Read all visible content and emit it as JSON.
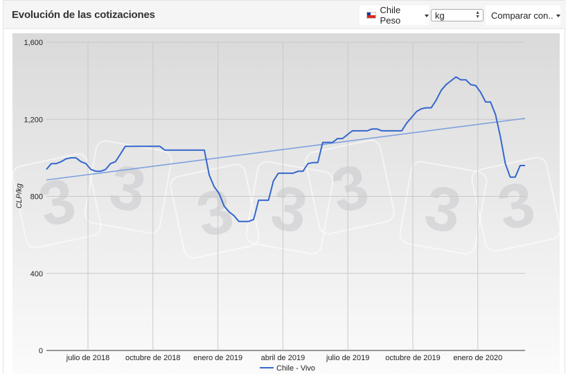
{
  "header": {
    "title": "Evolución de las cotizaciones",
    "currency_label": "Chile Peso",
    "unit_value": "kg",
    "compare_label": "Comparar con.."
  },
  "colors": {
    "series": "#3366cc",
    "trend": "#7fa0dd",
    "flag": [
      "#0039a6",
      "#ffffff",
      "#d52b1e"
    ]
  },
  "chart_data": {
    "type": "line",
    "ylabel": "CLP/kg",
    "ylim": [
      0,
      1600
    ],
    "yticks": [
      "0",
      "400",
      "800",
      "1,200",
      "1,600"
    ],
    "xtick_labels": [
      "julio de 2018",
      "octubre de 2018",
      "enero de 2019",
      "abril de 2019",
      "julio de 2019",
      "octubre de 2019",
      "enero de 2020"
    ],
    "grid": true,
    "legend_position": "bottom",
    "watermark": "3",
    "series": [
      {
        "name": "Chile - Vivo",
        "values": [
          940,
          970,
          970,
          980,
          995,
          1000,
          1000,
          980,
          970,
          940,
          930,
          930,
          940,
          970,
          980,
          1020,
          1060,
          1060,
          1060,
          1060,
          1060,
          1060,
          1060,
          1060,
          1040,
          1040,
          1040,
          1040,
          1040,
          1040,
          1040,
          1040,
          1040,
          910,
          850,
          815,
          750,
          720,
          700,
          670,
          670,
          670,
          680,
          780,
          780,
          780,
          880,
          920,
          920,
          920,
          920,
          930,
          930,
          970,
          975,
          975,
          1080,
          1080,
          1080,
          1100,
          1100,
          1120,
          1140,
          1140,
          1140,
          1140,
          1150,
          1150,
          1140,
          1140,
          1140,
          1140,
          1140,
          1180,
          1210,
          1240,
          1255,
          1260,
          1260,
          1300,
          1350,
          1380,
          1400,
          1420,
          1405,
          1405,
          1380,
          1375,
          1340,
          1290,
          1290,
          1225,
          1110,
          970,
          900,
          900,
          960,
          960
        ]
      },
      {
        "name": "",
        "trend_line": [
          885,
          1205
        ]
      }
    ]
  }
}
